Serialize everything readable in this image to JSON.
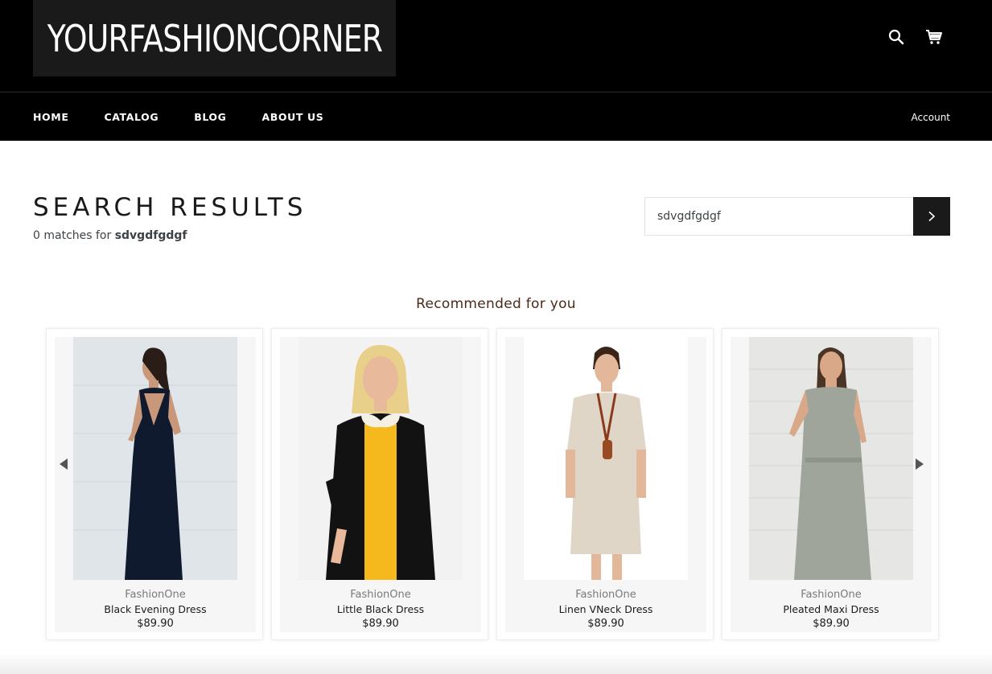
{
  "header": {
    "logo_text": "YOURFASHIONCORNER",
    "search_icon": "search-icon",
    "cart_icon": "cart-icon"
  },
  "nav": {
    "items": [
      {
        "label": "HOME"
      },
      {
        "label": "CATALOG"
      },
      {
        "label": "BLOG"
      },
      {
        "label": "ABOUT US"
      }
    ],
    "account_label": "Account"
  },
  "search": {
    "title": "SEARCH RESULTS",
    "match_prefix": "0 matches for ",
    "query": "sdvgdfgdgf",
    "input_value": "sdvgdfgdgf",
    "submit_icon": "chevron-right-icon"
  },
  "recommended": {
    "title": "Recommended for you",
    "products": [
      {
        "vendor": "FashionOne",
        "name": "Black Evening Dress",
        "price": "$89.90"
      },
      {
        "vendor": "FashionOne",
        "name": "Little Black Dress",
        "price": "$89.90"
      },
      {
        "vendor": "FashionOne",
        "name": "Linen VNeck Dress",
        "price": "$89.90"
      },
      {
        "vendor": "FashionOne",
        "name": "Pleated Maxi Dress",
        "price": "$89.90"
      }
    ],
    "prev_icon": "arrow-left-icon",
    "next_icon": "arrow-right-icon"
  },
  "colors": {
    "header_bg": "#000000",
    "button_bg": "#1a1a1a",
    "text": "#3d4246",
    "card_bg": "#f6f6f6"
  }
}
